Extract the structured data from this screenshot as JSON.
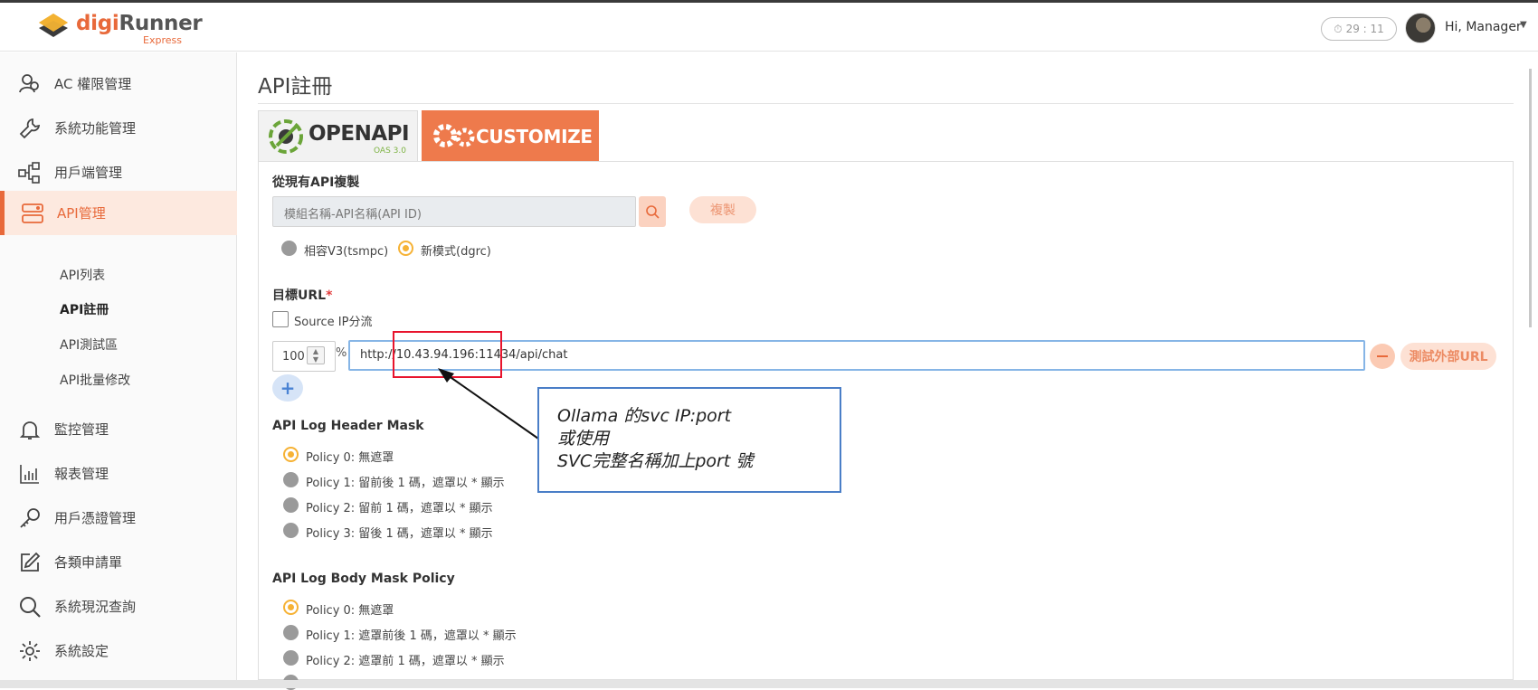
{
  "header": {
    "logo_brand_pre": "digi",
    "logo_brand_post": "Runner",
    "logo_sub": "Express",
    "timer": "29 : 11",
    "greeting": "Hi, Manager"
  },
  "sidebar": {
    "items": [
      {
        "label": "AC 權限管理",
        "icon": "users-icon"
      },
      {
        "label": "系統功能管理",
        "icon": "wrench-icon"
      },
      {
        "label": "用戶端管理",
        "icon": "client-tree-icon"
      },
      {
        "label": "API管理",
        "icon": "api-icon",
        "active": true
      },
      {
        "label": "監控管理",
        "icon": "bell-icon"
      },
      {
        "label": "報表管理",
        "icon": "bar-chart-icon"
      },
      {
        "label": "用戶憑證管理",
        "icon": "key-icon"
      },
      {
        "label": "各類申請單",
        "icon": "edit-icon"
      },
      {
        "label": "系統現況查詢",
        "icon": "search-icon"
      },
      {
        "label": "系統設定",
        "icon": "gear-icon"
      }
    ],
    "sub_items": [
      "API列表",
      "API註冊",
      "API測試區",
      "API批量修改"
    ]
  },
  "main": {
    "page_title": "API註冊",
    "tab_openapi": "OPENAPI",
    "tab_openapi_sub": "OAS 3.0",
    "tab_customize": "CUSTOMIZE",
    "copy_section_label": "從現有API複製",
    "copy_search_placeholder": "模組名稱-API名稱(API ID)",
    "copy_button": "複製",
    "mode_options": [
      "相容V3(tsmpc)",
      "新模式(dgrc)"
    ],
    "mode_selected": "新模式(dgrc)",
    "target_url_label": "目標URL",
    "required_mark": "*",
    "source_ip_label": "Source IP分流",
    "weight_value": "100",
    "percent_sign": "%",
    "url_value": "http://10.43.94.196:11434/api/chat",
    "test_button": "測試外部URL",
    "plus_button": "+",
    "header_mask_label": "API Log Header Mask",
    "header_mask_options": [
      "Policy 0: 無遮罩",
      "Policy 1: 留前後 1 碼，遮罩以 * 顯示",
      "Policy 2: 留前 1 碼，遮罩以 * 顯示",
      "Policy 3: 留後 1 碼，遮罩以 * 顯示"
    ],
    "body_mask_label": "API Log Body Mask Policy",
    "body_mask_options": [
      "Policy 0: 無遮罩",
      "Policy 1: 遮罩前後 1 碼，遮罩以 * 顯示",
      "Policy 2: 遮罩前 1 碼，遮罩以 * 顯示"
    ]
  },
  "annotation": {
    "lines": [
      "Ollama 的svc IP:port",
      "或使用",
      "SVC完整名稱加上port 號"
    ]
  },
  "colors": {
    "accent": "#e8693a",
    "customize_tab": "#ee7a4c",
    "callout_border": "#4a7ec7",
    "highlight_red": "#e8142d"
  }
}
